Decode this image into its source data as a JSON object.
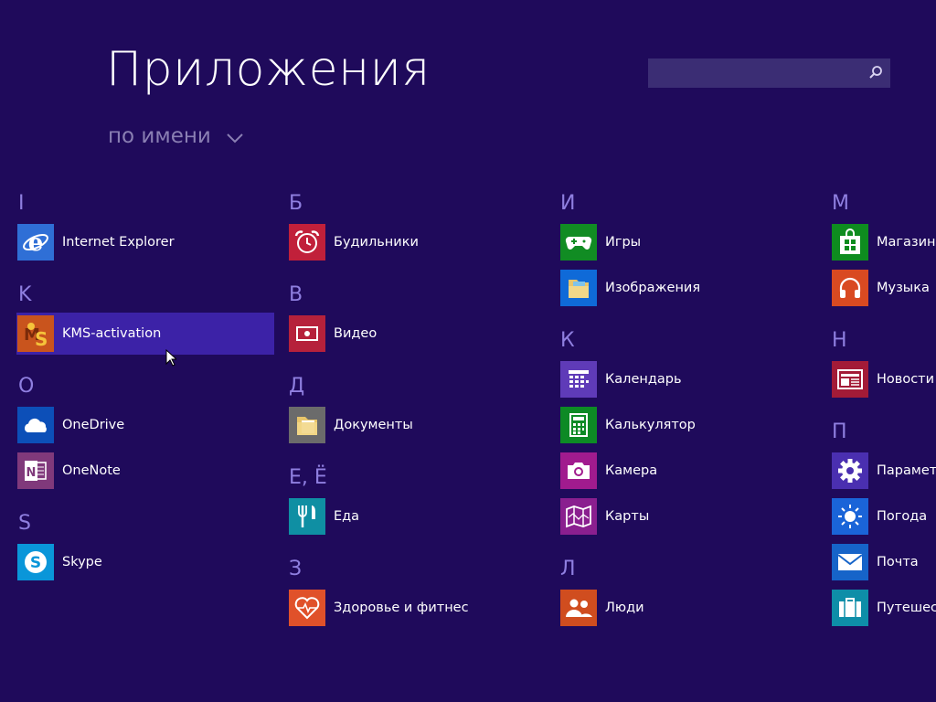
{
  "header": {
    "title": "Приложения",
    "sort_label": "по имени"
  },
  "search": {
    "value": "",
    "icon": "search-icon"
  },
  "colors": {
    "background": "#1f0a5b",
    "selected": "#3c22a7",
    "group_letter": "#8f7fe0"
  },
  "groups": {
    "g_I": "I",
    "g_K": "K",
    "g_O": "O",
    "g_S": "S",
    "g_B": "Б",
    "g_V": "В",
    "g_D": "Д",
    "g_E": "Е, Ё",
    "g_Z": "З",
    "g_Ii": "И",
    "g_Kk": "К",
    "g_L": "Л",
    "g_M": "М",
    "g_N": "Н",
    "g_P": "П"
  },
  "apps": {
    "ie": {
      "label": "Internet Explorer",
      "color": "#2f6fd6",
      "icon": "internet-explorer-icon"
    },
    "kms": {
      "label": "KMS-activation",
      "color": "#c9541d",
      "icon": "kms-activation-icon"
    },
    "onedrive": {
      "label": "OneDrive",
      "color": "#0c4fb8",
      "icon": "cloud-icon"
    },
    "onenote": {
      "label": "OneNote",
      "color": "#80397b",
      "icon": "onenote-icon"
    },
    "skype": {
      "label": "Skype",
      "color": "#0a96d9",
      "icon": "skype-icon"
    },
    "alarms": {
      "label": "Будильники",
      "color": "#c1203a",
      "icon": "alarm-clock-icon"
    },
    "video": {
      "label": "Видео",
      "color": "#b6213b",
      "icon": "video-icon"
    },
    "docs": {
      "label": "Документы",
      "color": "#6b6b6b",
      "icon": "folder-icon"
    },
    "food": {
      "label": "Еда",
      "color": "#0f8fa3",
      "icon": "fork-knife-icon"
    },
    "health": {
      "label": "Здоровье и фитнес",
      "color": "#e0512a",
      "icon": "heart-pulse-icon"
    },
    "games": {
      "label": "Игры",
      "color": "#118c23",
      "icon": "gamepad-icon"
    },
    "pictures": {
      "label": "Изображения",
      "color": "#0f6ad8",
      "icon": "pictures-folder-icon"
    },
    "calendar": {
      "label": "Календарь",
      "color": "#5f3bb8",
      "icon": "calendar-icon"
    },
    "calculator": {
      "label": "Калькулятор",
      "color": "#0d8a25",
      "icon": "calculator-icon"
    },
    "camera": {
      "label": "Камера",
      "color": "#a11b8e",
      "icon": "camera-icon"
    },
    "maps": {
      "label": "Карты",
      "color": "#8a1f8f",
      "icon": "map-icon"
    },
    "people": {
      "label": "Люди",
      "color": "#d04d1f",
      "icon": "people-icon"
    },
    "store": {
      "label": "Магазин",
      "color": "#0e8c1f",
      "icon": "store-bag-icon"
    },
    "music": {
      "label": "Музыка",
      "color": "#d94a21",
      "icon": "headphones-icon"
    },
    "news": {
      "label": "Новости",
      "color": "#a31b37",
      "icon": "news-icon"
    },
    "settings": {
      "label": "Параметры",
      "color": "#4a2fb0",
      "icon": "gear-icon"
    },
    "weather": {
      "label": "Погода",
      "color": "#1a64d8",
      "icon": "sun-icon"
    },
    "mail": {
      "label": "Почта",
      "color": "#1664c9",
      "icon": "mail-icon"
    },
    "travel": {
      "label": "Путешествия",
      "color": "#0e8ea8",
      "icon": "suitcase-icon"
    }
  }
}
